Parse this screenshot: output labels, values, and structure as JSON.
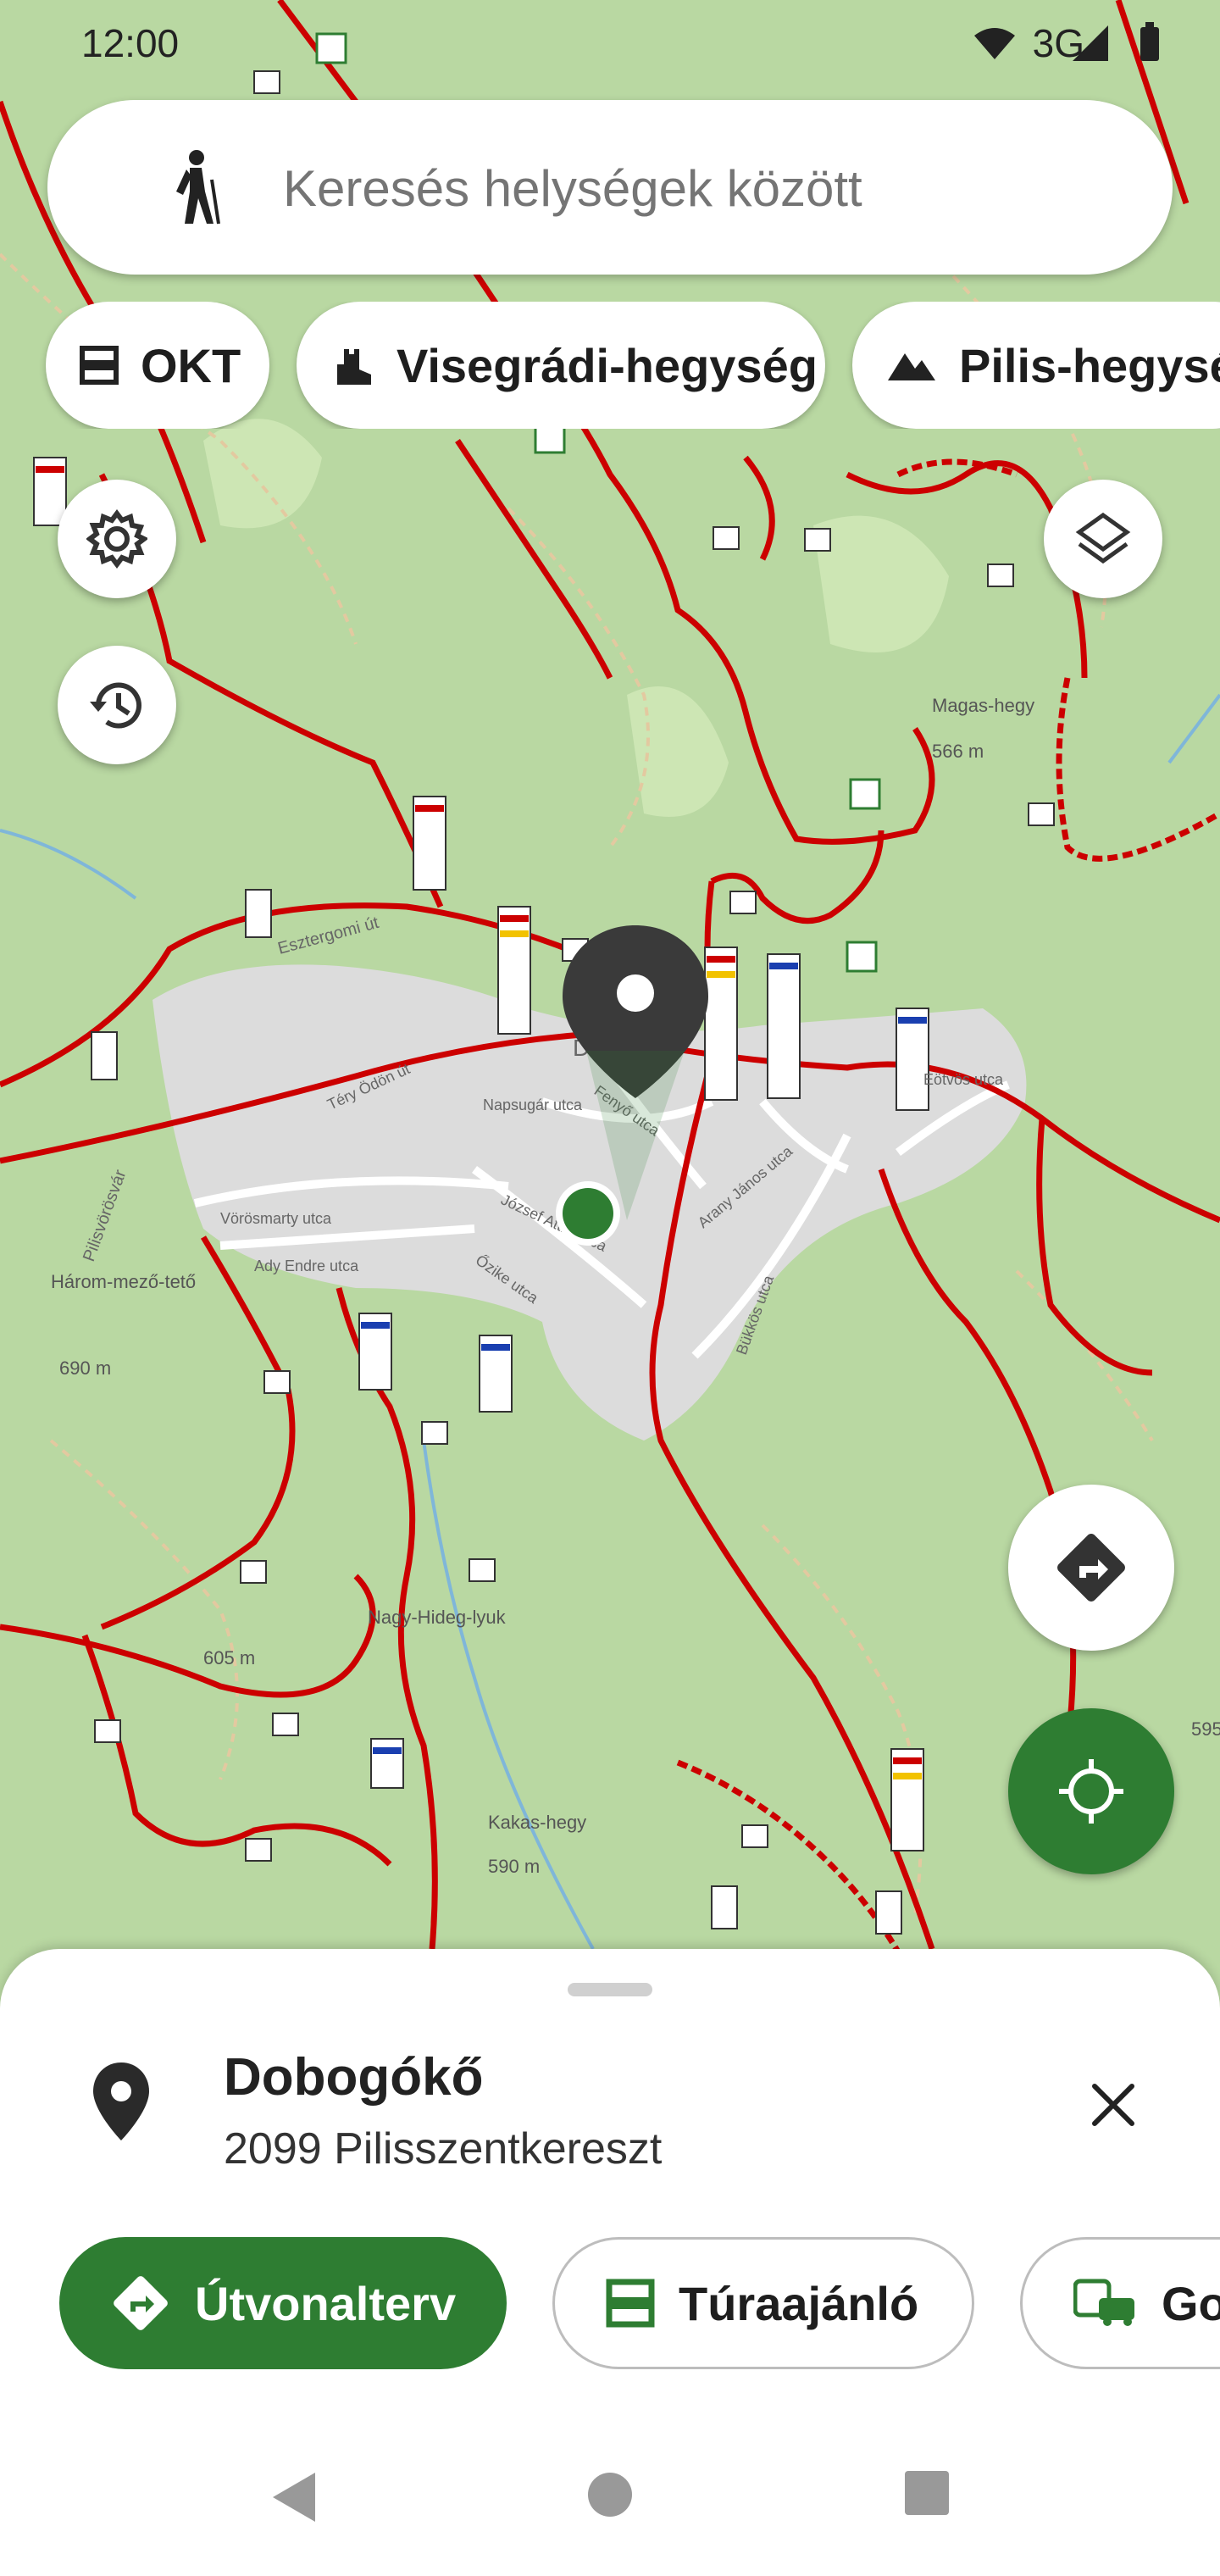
{
  "status_bar": {
    "time": "12:00",
    "network": "3G"
  },
  "search": {
    "placeholder": "Keresés helységek között"
  },
  "chips": [
    {
      "label": "OKT",
      "icon": "trail-marker-icon"
    },
    {
      "label": "Visegrádi-hegység",
      "icon": "castle-icon"
    },
    {
      "label": "Pilis-hegység",
      "icon": "mountain-icon"
    }
  ],
  "map": {
    "labels": {
      "village": "Dobogókő",
      "peak1": "Magas-hegy",
      "peak1_height": "566 m",
      "peak2": "Három-mező-tető",
      "peak2_height": "690 m",
      "cave": "Nagy-Hideg-lyuk",
      "peak3_height": "605 m",
      "peak4": "Kakas-hegy",
      "peak4_height": "590 m",
      "street1": "Vörösmarty utca",
      "street2": "Ady Endre utca",
      "street3": "József Attila utca",
      "street4": "Napsugár utca",
      "street5": "Fenyő utca",
      "street6": "Arany János utca",
      "street7": "Bükkös utca",
      "street8": "Eötvös utca",
      "street9": "Téry Ödön út",
      "street10": "Őzike utca",
      "road1": "Esztergomi út",
      "road2": "Pilisvörösvár",
      "height_edge": "595"
    }
  },
  "sheet": {
    "title": "Dobogókő",
    "address": "2099 Pilisszentkereszt",
    "actions": [
      {
        "label": "Útvonalterv",
        "icon": "directions-icon",
        "primary": true
      },
      {
        "label": "Túraajánló",
        "icon": "trail-marker-icon",
        "primary": false
      },
      {
        "label": "Go",
        "icon": "bus-car-icon",
        "primary": false
      }
    ]
  },
  "colors": {
    "accent": "#2e7d32",
    "trail": "#cc0000",
    "map_bg": "#b9d8a2",
    "village": "#dcdcdc"
  }
}
